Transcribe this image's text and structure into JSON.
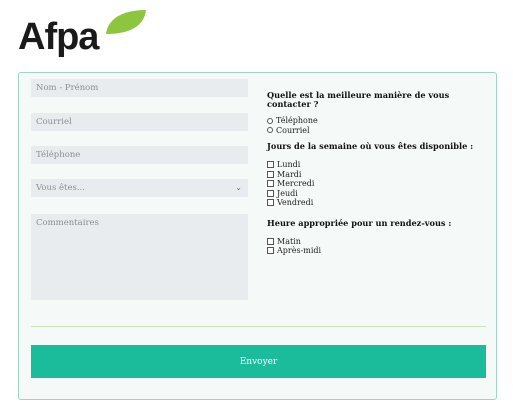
{
  "brand": {
    "name": "Afpa",
    "accent": "#8cc63f"
  },
  "form": {
    "name_placeholder": "Nom - Prénom",
    "email_placeholder": "Courriel",
    "phone_placeholder": "Téléphone",
    "status_select_value": "Vous êtes...",
    "comments_placeholder": "Commentaires",
    "contact_question": "Quelle est la meilleure manière de vous contacter ?",
    "contact_options": [
      "Téléphone",
      "Courriel"
    ],
    "days_question": "Jours de la semaine où vous êtes disponible :",
    "days": [
      "Lundi",
      "Mardi",
      "Mercredi",
      "Jeudi",
      "Vendredi"
    ],
    "time_question": "Heure appropriée pour un rendez-vous :",
    "times": [
      "Matin",
      "Après-midi"
    ],
    "submit_label": "Envoyer"
  },
  "colors": {
    "primary": "#1bbc9b",
    "border": "#9ed5c6",
    "field_bg": "#e8ecee"
  }
}
